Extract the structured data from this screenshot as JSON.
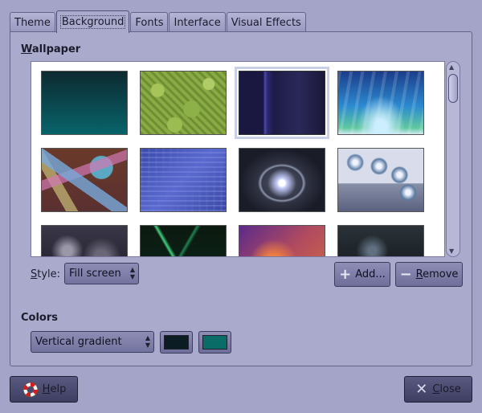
{
  "tabs": [
    {
      "label": "Theme"
    },
    {
      "label": "Background"
    },
    {
      "label": "Fonts"
    },
    {
      "label": "Interface"
    },
    {
      "label": "Visual Effects"
    }
  ],
  "wallpaper": {
    "heading_first": "W",
    "heading_rest": "allpaper",
    "selected_index": 2
  },
  "style": {
    "label_first": "S",
    "label_rest": "tyle:",
    "value": "Fill screen"
  },
  "buttons": {
    "add": "Add...",
    "remove_first": "R",
    "remove_rest": "emove",
    "help_first": "H",
    "help_rest": "elp",
    "close_first": "C",
    "close_rest": "lose"
  },
  "colors": {
    "heading": "Colors",
    "mode": "Vertical gradient",
    "primary": "#0b1c22",
    "secondary": "#0a6c66"
  }
}
